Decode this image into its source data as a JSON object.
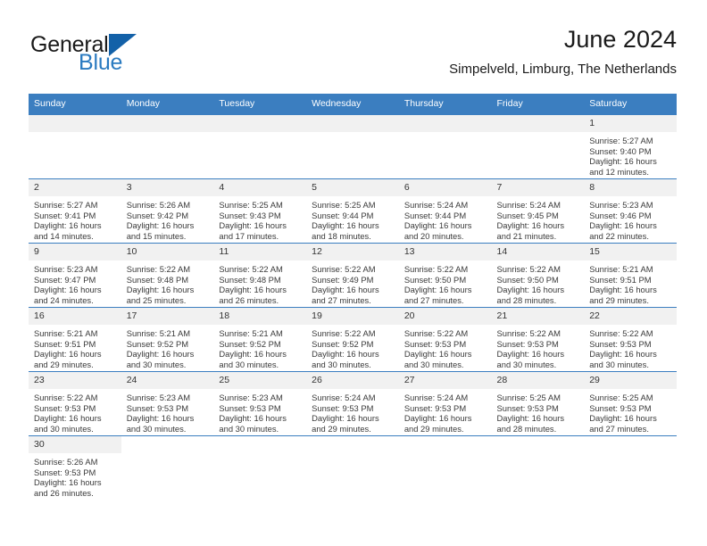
{
  "logo": {
    "word_one": "General",
    "word_two": "Blue",
    "triangle_icon": "triangle-icon",
    "brand_blue": "#2a7ac0",
    "triangle_blue": "#1361a8"
  },
  "header": {
    "month_title": "June 2024",
    "location": "Simpelveld, Limburg, The Netherlands"
  },
  "theme": {
    "header_blue": "#3b7ec0",
    "daynum_background": "#f1f1f1",
    "text_color": "#3a3a3a"
  },
  "calendar": {
    "weekday_headers": [
      "Sunday",
      "Monday",
      "Tuesday",
      "Wednesday",
      "Thursday",
      "Friday",
      "Saturday"
    ],
    "weeks": [
      [
        {
          "day": "",
          "blank": true
        },
        {
          "day": "",
          "blank": true
        },
        {
          "day": "",
          "blank": true
        },
        {
          "day": "",
          "blank": true
        },
        {
          "day": "",
          "blank": true
        },
        {
          "day": "",
          "blank": true
        },
        {
          "day": "1",
          "sunrise": "Sunrise: 5:27 AM",
          "sunset": "Sunset: 9:40 PM",
          "daylight": "Daylight: 16 hours and 12 minutes."
        }
      ],
      [
        {
          "day": "2",
          "sunrise": "Sunrise: 5:27 AM",
          "sunset": "Sunset: 9:41 PM",
          "daylight": "Daylight: 16 hours and 14 minutes."
        },
        {
          "day": "3",
          "sunrise": "Sunrise: 5:26 AM",
          "sunset": "Sunset: 9:42 PM",
          "daylight": "Daylight: 16 hours and 15 minutes."
        },
        {
          "day": "4",
          "sunrise": "Sunrise: 5:25 AM",
          "sunset": "Sunset: 9:43 PM",
          "daylight": "Daylight: 16 hours and 17 minutes."
        },
        {
          "day": "5",
          "sunrise": "Sunrise: 5:25 AM",
          "sunset": "Sunset: 9:44 PM",
          "daylight": "Daylight: 16 hours and 18 minutes."
        },
        {
          "day": "6",
          "sunrise": "Sunrise: 5:24 AM",
          "sunset": "Sunset: 9:44 PM",
          "daylight": "Daylight: 16 hours and 20 minutes."
        },
        {
          "day": "7",
          "sunrise": "Sunrise: 5:24 AM",
          "sunset": "Sunset: 9:45 PM",
          "daylight": "Daylight: 16 hours and 21 minutes."
        },
        {
          "day": "8",
          "sunrise": "Sunrise: 5:23 AM",
          "sunset": "Sunset: 9:46 PM",
          "daylight": "Daylight: 16 hours and 22 minutes."
        }
      ],
      [
        {
          "day": "9",
          "sunrise": "Sunrise: 5:23 AM",
          "sunset": "Sunset: 9:47 PM",
          "daylight": "Daylight: 16 hours and 24 minutes."
        },
        {
          "day": "10",
          "sunrise": "Sunrise: 5:22 AM",
          "sunset": "Sunset: 9:48 PM",
          "daylight": "Daylight: 16 hours and 25 minutes."
        },
        {
          "day": "11",
          "sunrise": "Sunrise: 5:22 AM",
          "sunset": "Sunset: 9:48 PM",
          "daylight": "Daylight: 16 hours and 26 minutes."
        },
        {
          "day": "12",
          "sunrise": "Sunrise: 5:22 AM",
          "sunset": "Sunset: 9:49 PM",
          "daylight": "Daylight: 16 hours and 27 minutes."
        },
        {
          "day": "13",
          "sunrise": "Sunrise: 5:22 AM",
          "sunset": "Sunset: 9:50 PM",
          "daylight": "Daylight: 16 hours and 27 minutes."
        },
        {
          "day": "14",
          "sunrise": "Sunrise: 5:22 AM",
          "sunset": "Sunset: 9:50 PM",
          "daylight": "Daylight: 16 hours and 28 minutes."
        },
        {
          "day": "15",
          "sunrise": "Sunrise: 5:21 AM",
          "sunset": "Sunset: 9:51 PM",
          "daylight": "Daylight: 16 hours and 29 minutes."
        }
      ],
      [
        {
          "day": "16",
          "sunrise": "Sunrise: 5:21 AM",
          "sunset": "Sunset: 9:51 PM",
          "daylight": "Daylight: 16 hours and 29 minutes."
        },
        {
          "day": "17",
          "sunrise": "Sunrise: 5:21 AM",
          "sunset": "Sunset: 9:52 PM",
          "daylight": "Daylight: 16 hours and 30 minutes."
        },
        {
          "day": "18",
          "sunrise": "Sunrise: 5:21 AM",
          "sunset": "Sunset: 9:52 PM",
          "daylight": "Daylight: 16 hours and 30 minutes."
        },
        {
          "day": "19",
          "sunrise": "Sunrise: 5:22 AM",
          "sunset": "Sunset: 9:52 PM",
          "daylight": "Daylight: 16 hours and 30 minutes."
        },
        {
          "day": "20",
          "sunrise": "Sunrise: 5:22 AM",
          "sunset": "Sunset: 9:53 PM",
          "daylight": "Daylight: 16 hours and 30 minutes."
        },
        {
          "day": "21",
          "sunrise": "Sunrise: 5:22 AM",
          "sunset": "Sunset: 9:53 PM",
          "daylight": "Daylight: 16 hours and 30 minutes."
        },
        {
          "day": "22",
          "sunrise": "Sunrise: 5:22 AM",
          "sunset": "Sunset: 9:53 PM",
          "daylight": "Daylight: 16 hours and 30 minutes."
        }
      ],
      [
        {
          "day": "23",
          "sunrise": "Sunrise: 5:22 AM",
          "sunset": "Sunset: 9:53 PM",
          "daylight": "Daylight: 16 hours and 30 minutes."
        },
        {
          "day": "24",
          "sunrise": "Sunrise: 5:23 AM",
          "sunset": "Sunset: 9:53 PM",
          "daylight": "Daylight: 16 hours and 30 minutes."
        },
        {
          "day": "25",
          "sunrise": "Sunrise: 5:23 AM",
          "sunset": "Sunset: 9:53 PM",
          "daylight": "Daylight: 16 hours and 30 minutes."
        },
        {
          "day": "26",
          "sunrise": "Sunrise: 5:24 AM",
          "sunset": "Sunset: 9:53 PM",
          "daylight": "Daylight: 16 hours and 29 minutes."
        },
        {
          "day": "27",
          "sunrise": "Sunrise: 5:24 AM",
          "sunset": "Sunset: 9:53 PM",
          "daylight": "Daylight: 16 hours and 29 minutes."
        },
        {
          "day": "28",
          "sunrise": "Sunrise: 5:25 AM",
          "sunset": "Sunset: 9:53 PM",
          "daylight": "Daylight: 16 hours and 28 minutes."
        },
        {
          "day": "29",
          "sunrise": "Sunrise: 5:25 AM",
          "sunset": "Sunset: 9:53 PM",
          "daylight": "Daylight: 16 hours and 27 minutes."
        }
      ],
      [
        {
          "day": "30",
          "sunrise": "Sunrise: 5:26 AM",
          "sunset": "Sunset: 9:53 PM",
          "daylight": "Daylight: 16 hours and 26 minutes."
        },
        {
          "day": "",
          "blank": true
        },
        {
          "day": "",
          "blank": true
        },
        {
          "day": "",
          "blank": true
        },
        {
          "day": "",
          "blank": true
        },
        {
          "day": "",
          "blank": true
        },
        {
          "day": "",
          "blank": true
        }
      ]
    ]
  }
}
